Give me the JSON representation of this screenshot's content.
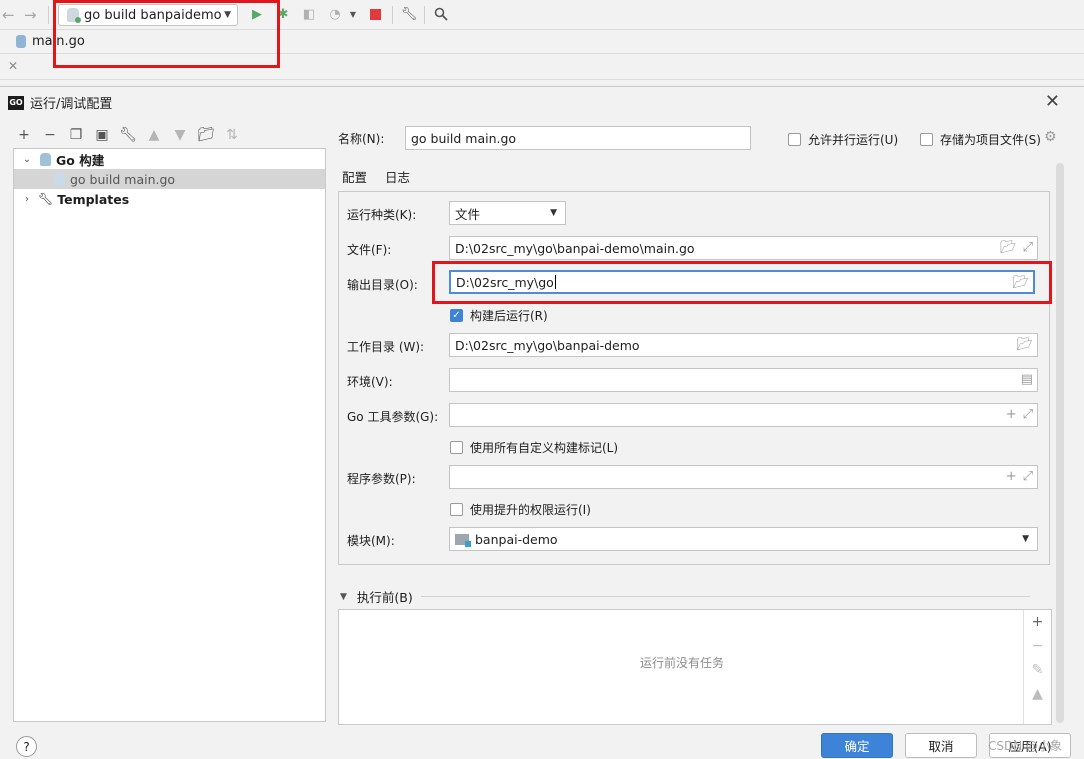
{
  "ide": {
    "run_config_label": "go build banpaidemo",
    "breadcrumb_file": "main.go"
  },
  "dialog": {
    "title": "运行/调试配置",
    "tree": {
      "group_label": "Go 构建",
      "config_item": "go build main.go",
      "templates_label": "Templates"
    },
    "name_label": "名称(N):",
    "name_value": "go build main.go",
    "allow_parallel_label": "允许并行运行(U)",
    "store_as_project_label": "存储为项目文件(S)",
    "tabs": [
      "配置",
      "日志"
    ],
    "fields": {
      "run_kind_label": "运行种类(K):",
      "run_kind_value": "文件",
      "file_label": "文件(F):",
      "file_value": "D:\\02src_my\\go\\banpai-demo\\main.go",
      "output_dir_label": "输出目录(O):",
      "output_dir_value": "D:\\02src_my\\go",
      "run_after_build_label": "构建后运行(R)",
      "working_dir_label": "工作目录 (W):",
      "working_dir_value": "D:\\02src_my\\go\\banpai-demo",
      "env_label": "环境(V):",
      "env_value": "",
      "go_tool_args_label": "Go 工具参数(G):",
      "go_tool_args_value": "",
      "use_custom_tags_label": "使用所有自定义构建标记(L)",
      "program_args_label": "程序参数(P):",
      "program_args_value": "",
      "run_elevated_label": "使用提升的权限运行(I)",
      "module_label": "模块(M):",
      "module_value": "banpai-demo"
    },
    "checkbox_states": {
      "allow_parallel": false,
      "store_as_project": false,
      "run_after_build": true,
      "use_custom_tags": false,
      "run_elevated": false
    },
    "before_launch_label": "执行前(B)",
    "before_launch_empty": "运行前没有任务",
    "buttons": {
      "ok": "确定",
      "cancel": "取消",
      "apply": "应用(A)"
    },
    "watermark": "CSDN @小象"
  },
  "colors": {
    "accent": "#3d84d8",
    "highlight_red": "#e0161c",
    "run_green": "#59a869",
    "stop_red": "#e0393e"
  }
}
